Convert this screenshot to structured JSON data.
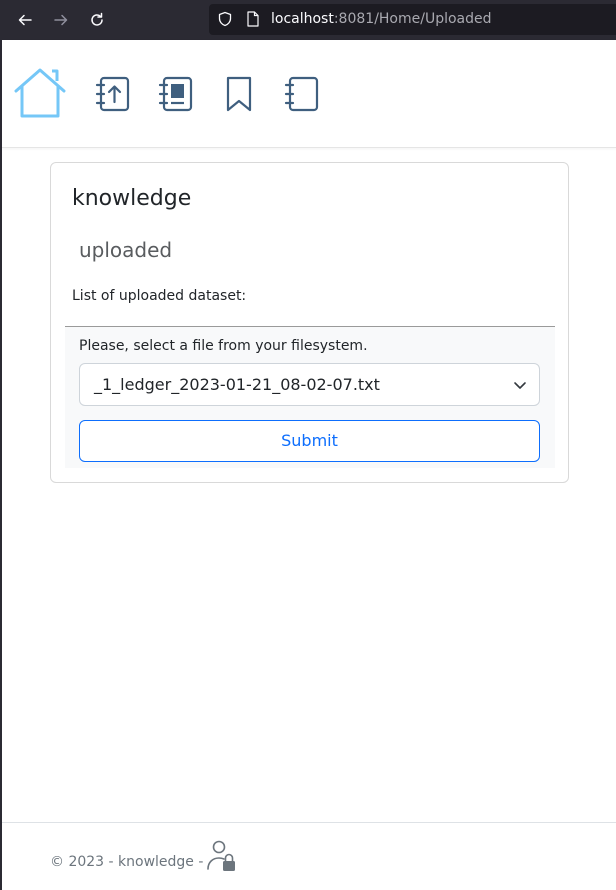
{
  "browser": {
    "url_host": "localhost",
    "url_rest": ":8081/Home/Uploaded"
  },
  "nav": {
    "items": [
      {
        "icon": "home-icon"
      },
      {
        "icon": "notebook-upload-icon"
      },
      {
        "icon": "notebook-filled-icon"
      },
      {
        "icon": "bookmark-icon"
      },
      {
        "icon": "notebook-icon"
      }
    ],
    "accent_color": "#75c7f7",
    "icon_color": "#3f5f7f"
  },
  "card": {
    "title": "knowledge",
    "subtitle": "uploaded",
    "list_label": "List of uploaded dataset:",
    "form": {
      "hint": "Please, select a file from your filesystem.",
      "selected_file": "_1_ledger_2023-01-21_08-02-07.txt",
      "submit_label": "Submit"
    }
  },
  "footer": {
    "text": "© 2023 - knowledge -",
    "icon": "user-lock-icon"
  },
  "colors": {
    "primary": "#0d6efd",
    "browser_chrome": "#2b2a33"
  }
}
